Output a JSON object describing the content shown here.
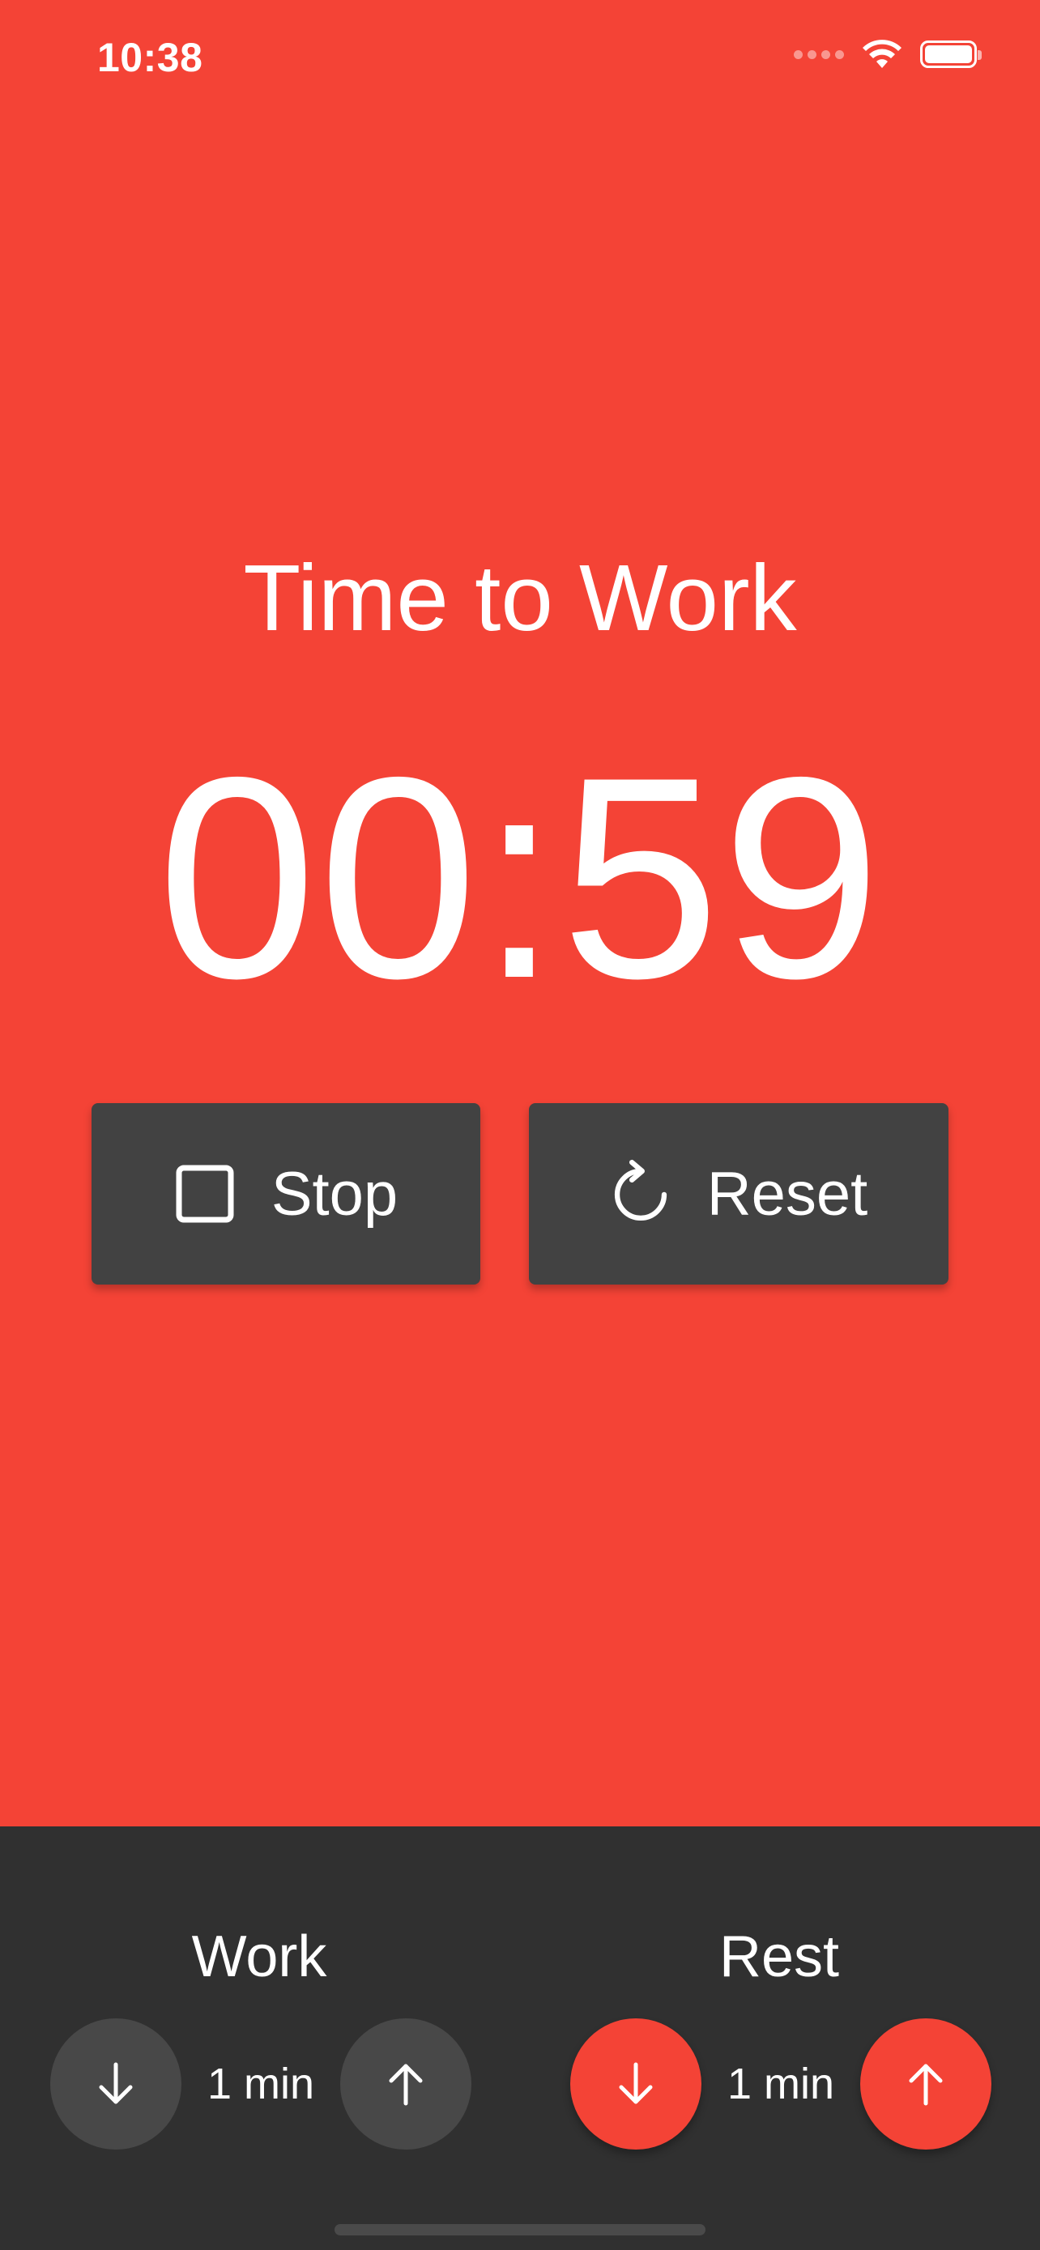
{
  "status_bar": {
    "time": "10:38",
    "icons": [
      "signal-icon",
      "wifi-icon",
      "battery-icon"
    ]
  },
  "timer": {
    "mode_title": "Time to Work",
    "display": "00:59",
    "stop_label": "Stop",
    "reset_label": "Reset",
    "stop_icon": "stop-square-icon",
    "reset_icon": "refresh-icon"
  },
  "settings": {
    "work": {
      "label": "Work",
      "value": "1 min",
      "decrease_icon": "arrow-down-icon",
      "increase_icon": "arrow-up-icon"
    },
    "rest": {
      "label": "Rest",
      "value": "1 min",
      "decrease_icon": "arrow-down-icon",
      "increase_icon": "arrow-up-icon"
    }
  },
  "colors": {
    "background_accent": "#f44336",
    "button_dark": "#424242",
    "panel": "#303030",
    "text": "#ffffff"
  }
}
